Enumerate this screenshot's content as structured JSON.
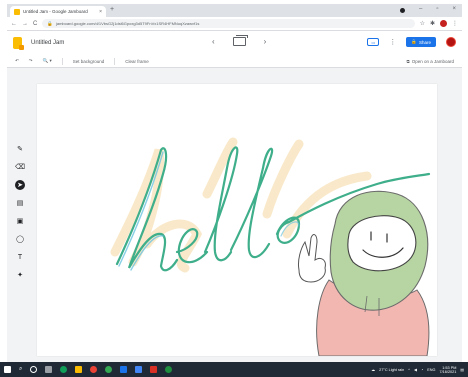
{
  "browser": {
    "tab_title": "Untitled Jam - Google Jamboard",
    "tab_close": "×",
    "new_tab": "+",
    "url": "jamboard.google.com/d/1VbsG2j1dsl6Gpoxg3d5T9FnVx1SR4HFMNuqXzawvf1s",
    "back": "←",
    "forward": "→",
    "reload": "C",
    "lock": "🔒"
  },
  "app": {
    "jam_title": "Untitled Jam",
    "prev_frame": "‹",
    "next_frame": "›",
    "cast_label": "▭",
    "more_menu": "⋮",
    "share_label": "Share",
    "share_icon": "🔒"
  },
  "toolbar": {
    "undo": "↶",
    "redo": "↷",
    "zoom_label": "🔍",
    "zoom_caret": "▾",
    "set_background": "Set background",
    "clear_frame": "Clear frame",
    "open_on_jamboard": "Open on a Jamboard"
  },
  "tools": [
    {
      "name": "pen-tool",
      "glyph": "✎"
    },
    {
      "name": "eraser-tool",
      "glyph": "⌫"
    },
    {
      "name": "select-tool",
      "glyph": "➤"
    },
    {
      "name": "sticky-note-tool",
      "glyph": "▤"
    },
    {
      "name": "image-tool",
      "glyph": "▣"
    },
    {
      "name": "circle-tool",
      "glyph": "◯"
    },
    {
      "name": "text-box-tool",
      "glyph": "T"
    },
    {
      "name": "laser-tool",
      "glyph": "✦"
    }
  ],
  "taskbar": {
    "search_glyph": "⌕",
    "weather": "27°C Light rain",
    "lang": "ENG",
    "time": "1:53 PM",
    "date": "7/16/2021"
  },
  "colors": {
    "share_blue": "#1a73e8",
    "ink_green": "#3fae8a",
    "ink_highlight": "#f7e2b8",
    "hood_green": "#b7d5a2",
    "body_pink": "#f3b7b2",
    "taskbar": "#1f2a36"
  }
}
